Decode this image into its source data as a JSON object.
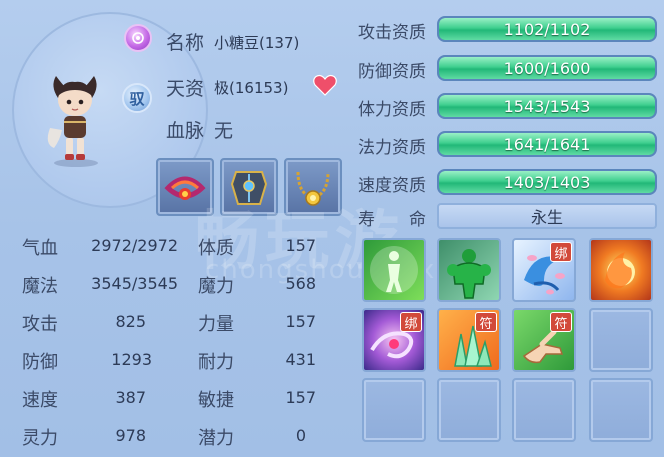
{
  "pet": {
    "name_label": "名称",
    "name_value": "小糖豆(137)",
    "talent_label": "天资",
    "talent_value": "极(16153)",
    "blood_label": "血脉",
    "blood_value": "无",
    "tame_badge": "驭"
  },
  "equipment": [
    {
      "icon": "red-collar-icon"
    },
    {
      "icon": "armor-icon"
    },
    {
      "icon": "gold-necklace-icon"
    }
  ],
  "stats": [
    {
      "label": "气血",
      "value": "2972/2972",
      "label2": "体质",
      "value2": "157"
    },
    {
      "label": "魔法",
      "value": "3545/3545",
      "label2": "魔力",
      "value2": "568"
    },
    {
      "label": "攻击",
      "value": "825",
      "label2": "力量",
      "value2": "157"
    },
    {
      "label": "防御",
      "value": "1293",
      "label2": "耐力",
      "value2": "431"
    },
    {
      "label": "速度",
      "value": "387",
      "label2": "敏捷",
      "value2": "157"
    },
    {
      "label": "灵力",
      "value": "978",
      "label2": "潜力",
      "value2": "0"
    }
  ],
  "aptitudes": [
    {
      "label": "攻击资质",
      "value": "1102/1102",
      "fraction": 1.0
    },
    {
      "label": "防御资质",
      "value": "1600/1600",
      "fraction": 1.0
    },
    {
      "label": "体力资质",
      "value": "1543/1543",
      "fraction": 1.0
    },
    {
      "label": "法力资质",
      "value": "1641/1641",
      "fraction": 1.0
    },
    {
      "label": "速度资质",
      "value": "1403/1403",
      "fraction": 1.0
    }
  ],
  "life": {
    "label": "寿　　命",
    "value": "永生"
  },
  "skills": [
    {
      "icon": "green-figure-skill-icon",
      "badge": ""
    },
    {
      "icon": "green-muscle-skill-icon",
      "badge": ""
    },
    {
      "icon": "petal-swirl-skill-icon",
      "badge": "绑"
    },
    {
      "icon": "fireball-skill-icon",
      "badge": ""
    },
    {
      "icon": "purple-vortex-skill-icon",
      "badge": "绑"
    },
    {
      "icon": "crystal-skill-icon",
      "badge": "符"
    },
    {
      "icon": "hand-seal-skill-icon",
      "badge": "符"
    }
  ],
  "watermark": {
    "main": "畅玩游",
    "sub": "chongshouyouxi"
  },
  "colors": {
    "bar_fill": "#3fcf8f",
    "badge": "#d24a3a",
    "panel": "#a9c6ea"
  }
}
